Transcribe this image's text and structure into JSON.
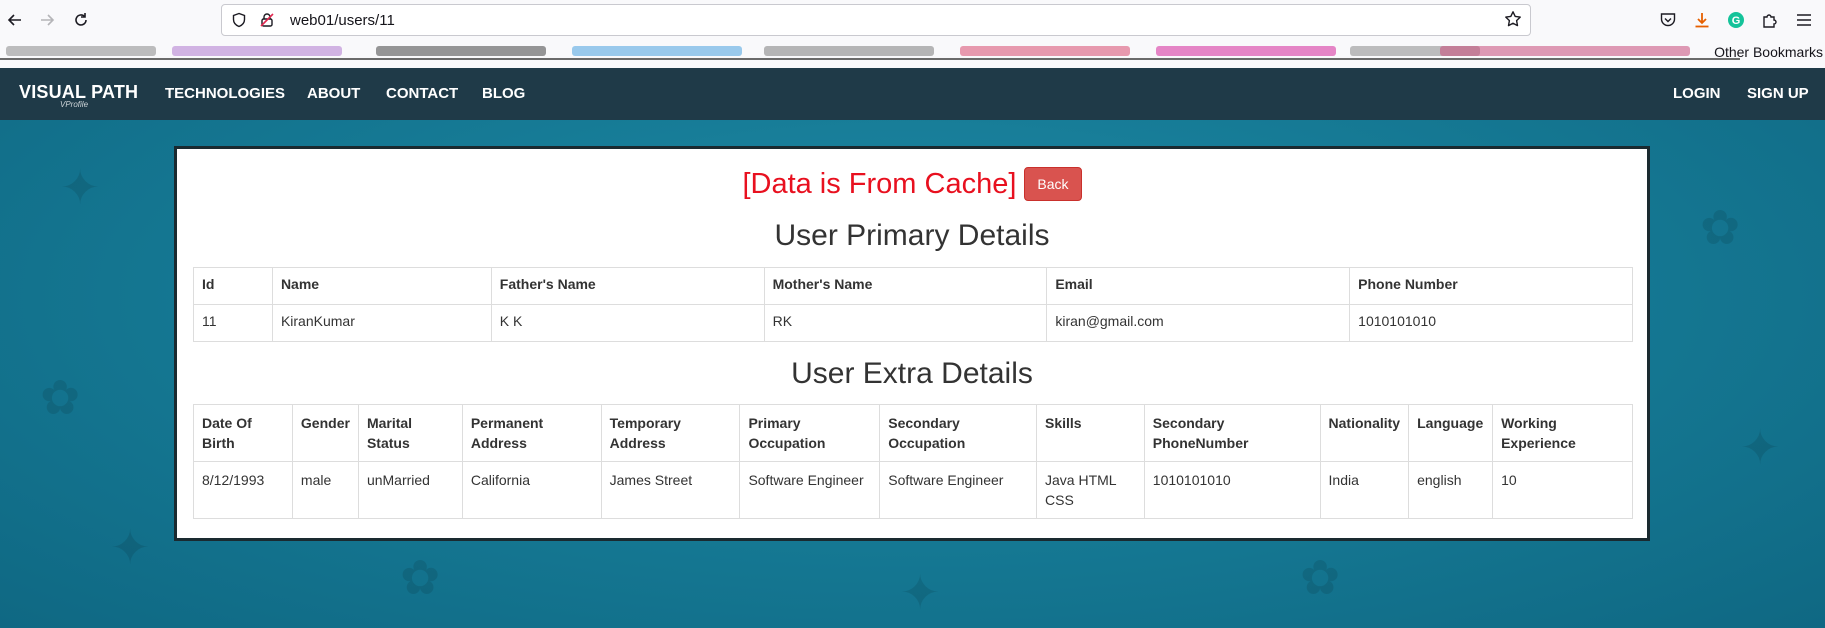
{
  "browser": {
    "url": "web01/users/11",
    "other_bookmarks": "Other Bookmarks"
  },
  "nav": {
    "brand": "VISUAL PATH",
    "brand_sub": "VProfile",
    "links": [
      "TECHNOLOGIES",
      "ABOUT",
      "CONTACT",
      "BLOG"
    ],
    "right_links": [
      "LOGIN",
      "SIGN UP"
    ]
  },
  "card": {
    "cache_message": "[Data is From Cache]",
    "back_label": "Back",
    "primary_title": "User Primary Details",
    "extra_title": "User Extra Details"
  },
  "primary_table": {
    "headers": [
      "Id",
      "Name",
      "Father's Name",
      "Mother's Name",
      "Email",
      "Phone Number"
    ],
    "rows": [
      [
        "11",
        "KiranKumar",
        "K K",
        "RK",
        "kiran@gmail.com",
        "1010101010"
      ]
    ]
  },
  "extra_table": {
    "headers": [
      "Date Of Birth",
      "Gender",
      "Marital Status",
      "Permanent Address",
      "Temporary Address",
      "Primary Occupation",
      "Secondary Occupation",
      "Skills",
      "Secondary PhoneNumber",
      "Nationality",
      "Language",
      "Working Experience"
    ],
    "rows": [
      [
        "8/12/1993",
        "male",
        "unMarried",
        "California",
        "James Street",
        "Software Engineer",
        "Software Engineer",
        "Java HTML CSS",
        "1010101010",
        "India",
        "english",
        "10"
      ]
    ]
  },
  "colors": {
    "nav_bg": "#1f3a48",
    "cache_text": "#e8101f",
    "back_button": "#d9534f",
    "page_bg": "#167b96"
  }
}
